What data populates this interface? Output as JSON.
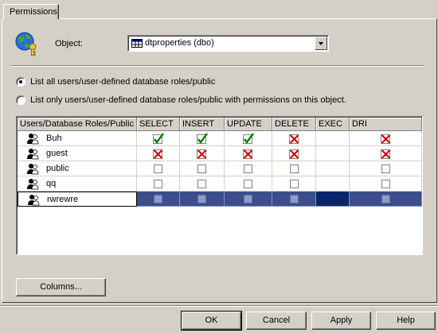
{
  "tab": {
    "label": "Permissions"
  },
  "object": {
    "label": "Object:",
    "value": "dtproperties (dbo)"
  },
  "options": [
    {
      "label": "List all users/user-defined database roles/public",
      "selected": true
    },
    {
      "label": "List only users/user-defined database roles/public with permissions on this object.",
      "selected": false
    }
  ],
  "grid": {
    "columns": [
      "Users/Database Roles/Public",
      "SELECT",
      "INSERT",
      "UPDATE",
      "DELETE",
      "EXEC",
      "DRI"
    ],
    "rows": [
      {
        "name": "Buh",
        "perms": [
          "granted",
          "granted",
          "granted",
          "denied",
          "none",
          "denied"
        ]
      },
      {
        "name": "guest",
        "perms": [
          "denied",
          "denied",
          "denied",
          "denied",
          "none",
          "denied"
        ]
      },
      {
        "name": "public",
        "perms": [
          "empty",
          "empty",
          "empty",
          "empty",
          "none",
          "empty"
        ]
      },
      {
        "name": "qq",
        "perms": [
          "empty",
          "empty",
          "empty",
          "empty",
          "none",
          "empty"
        ]
      },
      {
        "name": "rwrewre",
        "perms": [
          "empty",
          "empty",
          "empty",
          "empty",
          "none",
          "empty"
        ],
        "selected": true
      }
    ]
  },
  "columns_button": "Columns...",
  "buttons": {
    "ok": "OK",
    "cancel": "Cancel",
    "apply": "Apply",
    "help": "Help"
  },
  "colors": {
    "granted": "#008000",
    "denied": "#cc0000",
    "selection": "#3d4e8c"
  }
}
